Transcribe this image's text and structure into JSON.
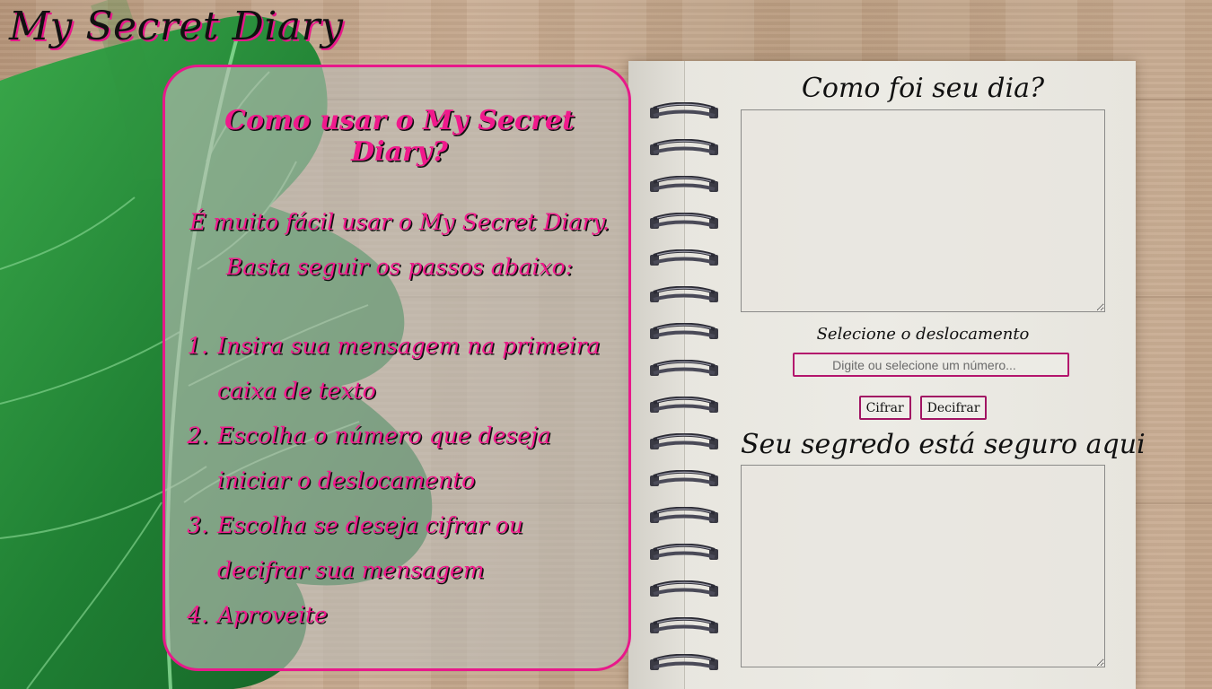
{
  "app": {
    "title": "My Secret Diary"
  },
  "instructions": {
    "heading": "Como usar o My Secret Diary?",
    "intro_line1": "É muito fácil usar o My Secret Diary.",
    "intro_line2": "Basta seguir os passos abaixo:",
    "steps": [
      "Insira sua mensagem na primeira caixa de texto",
      "Escolha o número que deseja iniciar o deslocamento",
      "Escolha se deseja cifrar ou decifrar sua mensagem",
      "Aproveite"
    ]
  },
  "form": {
    "input_heading": "Como foi seu dia?",
    "input_text": "",
    "shift_label": "Selecione o deslocamento",
    "shift_placeholder": "Digite ou selecione um número...",
    "encrypt_label": "Cifrar",
    "decrypt_label": "Decifrar",
    "output_heading": "Seu segredo está seguro aqui",
    "output_text": ""
  },
  "colors": {
    "accent": "#e8188a",
    "title_text": "#111111",
    "panel_border": "#e8188a",
    "button_border": "#a11463"
  },
  "decor": {
    "background": "wood-texture",
    "leaf": "monstera-leaf-illustration",
    "notebook": "spiral-notebook"
  }
}
